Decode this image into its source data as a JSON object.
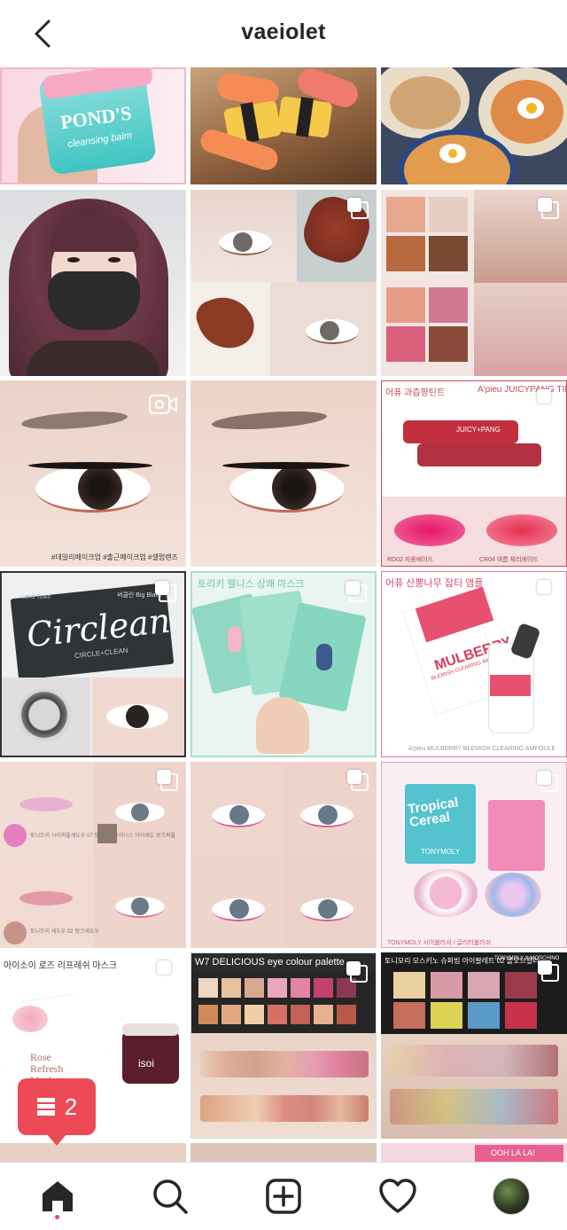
{
  "header": {
    "title": "vaeiolet",
    "back_icon": "chevron-left-icon"
  },
  "captions": {
    "c7": "#데일리메이크업 #출근메이크업 #셀럽렌즈",
    "c9_title_left": "어퓨 과즙팡틴트",
    "c9_title_right": "A'pieu JUICYPANG TINT",
    "c9_tube": "JUICY+PANG",
    "c9_shade1": "RD02 자몽에이드",
    "c9_shade2": "CR04 여름 체리에이드",
    "c10_brand": "Lens Town",
    "c10_product": "Circlean",
    "c10_sub": "CIRCLE+CLEAN",
    "c10_kr": "써클린 Big Black",
    "c11_title": "토리키 웰니스 상쾌 마스크",
    "c12_title": "어퓨 산뽕나무 잡티 앰플",
    "c12_product": "MULBERRY",
    "c12_sub": "BLEMISH CLEARING AMPOULE",
    "c12_bottom": "A'pieu MULBERRY BLEMISH CLEARING AMPOULE",
    "c13_a": "토니모리 시어퍼플섀도우 07 핑크스위트",
    "c13_b": "이니스 아이섀도 로즈퍼플",
    "c13_c": "토니모리 섀도우 02 핑크섀도우",
    "c15_brand": "TONYMOLY",
    "c15_product": "Tropical Cereal",
    "c15_bottom": "TONYMOLY 시어블러셔 / 글리터블러쉬",
    "c16_title": "아이소이 로즈 리프레쉬 마스크",
    "c16_product": "Rose Refresh Mask",
    "c16_brand": "isoi",
    "c17_title": "W7 DELICIOUS eye colour palette",
    "c18_title": "토니모리 모스키노 슈퍼빔 아이팔레트 02 올오브컬러",
    "c18_right": "TONYMOLY X MOSCHINO",
    "c19_text": "OOH LA LA!",
    "c1_brand": "POND'S",
    "c1_sub": "cleansing balm"
  },
  "notification": {
    "icon": "post-stack-icon",
    "count": "2"
  },
  "tabbar": {
    "home": "home-icon",
    "search": "search-icon",
    "add": "add-post-icon",
    "activity": "heart-icon",
    "profile": "profile-avatar"
  }
}
